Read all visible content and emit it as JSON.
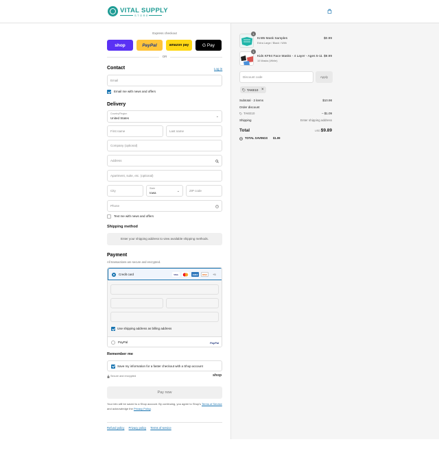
{
  "header": {
    "brand_title": "VITAL SUPPLY",
    "brand_sub": "STORE"
  },
  "express": {
    "title": "Express checkout",
    "shop": "shop",
    "paypal": "PayPal",
    "amazon": "amazon pay",
    "gpay": "G Pay",
    "or": "OR"
  },
  "contact": {
    "heading": "Contact",
    "login": "Log in",
    "email_placeholder": "Email",
    "news_label": "Email me with news and offers"
  },
  "delivery": {
    "heading": "Delivery",
    "country_label": "Country/Region",
    "country_value": "United States",
    "first_name": "First name",
    "last_name": "Last name",
    "company": "Company (optional)",
    "address": "Address",
    "apartment": "Apartment, suite, etc. (optional)",
    "city": "City",
    "state_label": "State",
    "state_value": "Iowa",
    "zip": "ZIP code",
    "phone": "Phone",
    "text_offers": "Text me with news and offers"
  },
  "shipping": {
    "heading": "Shipping method",
    "message": "Enter your shipping address to view available shipping methods."
  },
  "payment": {
    "heading": "Payment",
    "subtitle": "All transactions are secure and encrypted.",
    "credit_card": "Credit card",
    "cards": [
      "VISA",
      "MC",
      "AMEX",
      "DISC"
    ],
    "more_cards": "+5",
    "billing_label": "Use shipping address as billing address",
    "paypal": "PayPal"
  },
  "remember": {
    "heading": "Remember me",
    "save_label": "Save my information for a faster checkout with a Shop account",
    "secure": "Secure and encrypted",
    "shop": "shop"
  },
  "paynow": "Pay now",
  "terms": {
    "text1": "Your info will be saved to a Shop account. By continuing, you agree to Shop's",
    "terms_link": "Terms of Service",
    "text2": "and acknowledge the",
    "privacy_link": "Privacy Policy",
    "period": "."
  },
  "footer": {
    "refund": "Refund policy",
    "privacy": "Privacy policy",
    "tos": "Terms of service"
  },
  "summary": {
    "items": [
      {
        "qty": "1",
        "name": "Kn95 Mask Samples",
        "variant": "Extra Large / Black / With",
        "price": "$0.99"
      },
      {
        "qty": "1",
        "name": "Kids KF94 Face Masks - 4 Layer - Ages 5-11",
        "variant": "10 Masks (White)",
        "price": "$9.99"
      }
    ],
    "discount_placeholder": "Discount code",
    "apply": "Apply",
    "tag": "TAKE10",
    "subtotal_label": "Subtotal · 2 items",
    "subtotal_value": "$10.98",
    "order_discount": "Order discount",
    "discount_code": "TAKE10",
    "discount_value": "– $1.09",
    "shipping_label": "Shipping",
    "shipping_value": "Enter shipping address",
    "total_label": "Total",
    "currency": "USD",
    "total_value": "$9.89",
    "savings_label": "TOTAL SAVINGS",
    "savings_value": "$1.09"
  },
  "colors": {
    "accent": "#1773b0",
    "brand": "#1f9c95",
    "shop_purple": "#5a31f4"
  }
}
